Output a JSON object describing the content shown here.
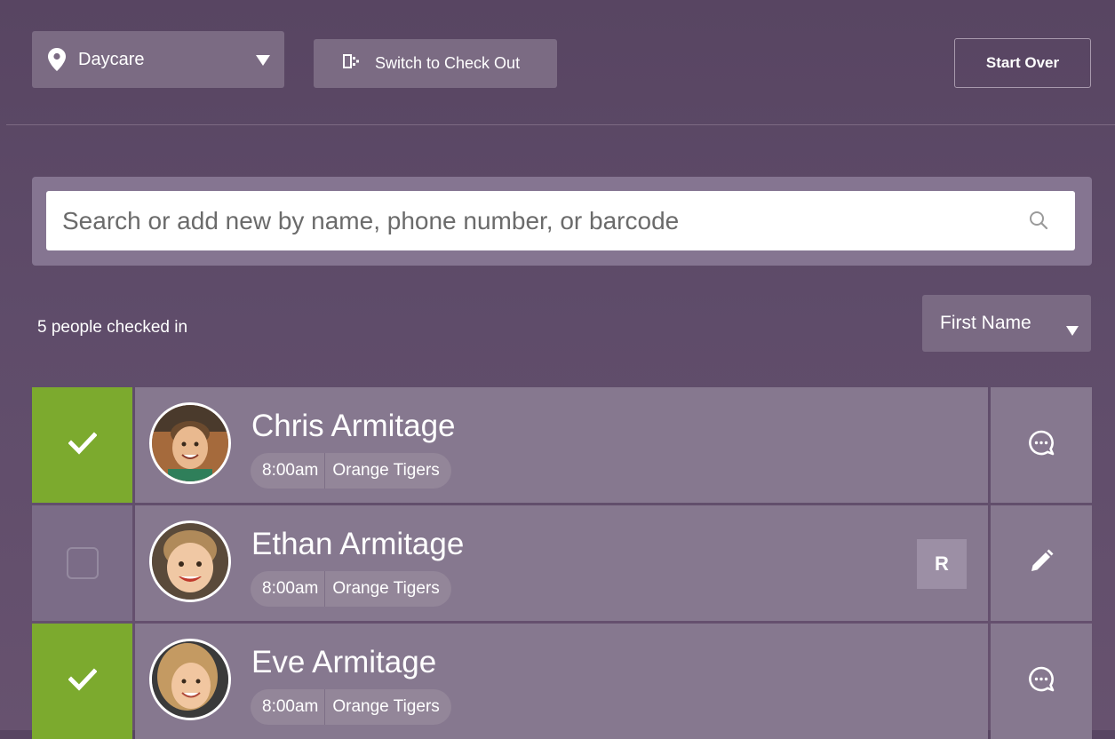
{
  "header": {
    "location_select": {
      "value": "Daycare",
      "icon": "map-pin-icon"
    },
    "switch_button": {
      "label": "Switch to Check Out",
      "icon": "switch-icon"
    },
    "start_over_label": "Start Over"
  },
  "search": {
    "placeholder": "Search or add new by name, phone number, or barcode",
    "value": "",
    "icon": "search-icon"
  },
  "summary": {
    "count_text": "5 people checked in"
  },
  "sort": {
    "selected": "First Name"
  },
  "people": [
    {
      "name": "Chris Armitage",
      "time": "8:00am",
      "room": "Orange Tigers",
      "checked": true,
      "badge": "",
      "action_icon": "message-icon"
    },
    {
      "name": "Ethan Armitage",
      "time": "8:00am",
      "room": "Orange Tigers",
      "checked": false,
      "badge": "R",
      "action_icon": "pencil-icon"
    },
    {
      "name": "Eve Armitage",
      "time": "8:00am",
      "room": "Orange Tigers",
      "checked": true,
      "badge": "",
      "action_icon": "message-icon"
    }
  ],
  "colors": {
    "background": "#5f4c6a",
    "checked_green": "#7caa2e",
    "row_bg": "#86788f"
  }
}
